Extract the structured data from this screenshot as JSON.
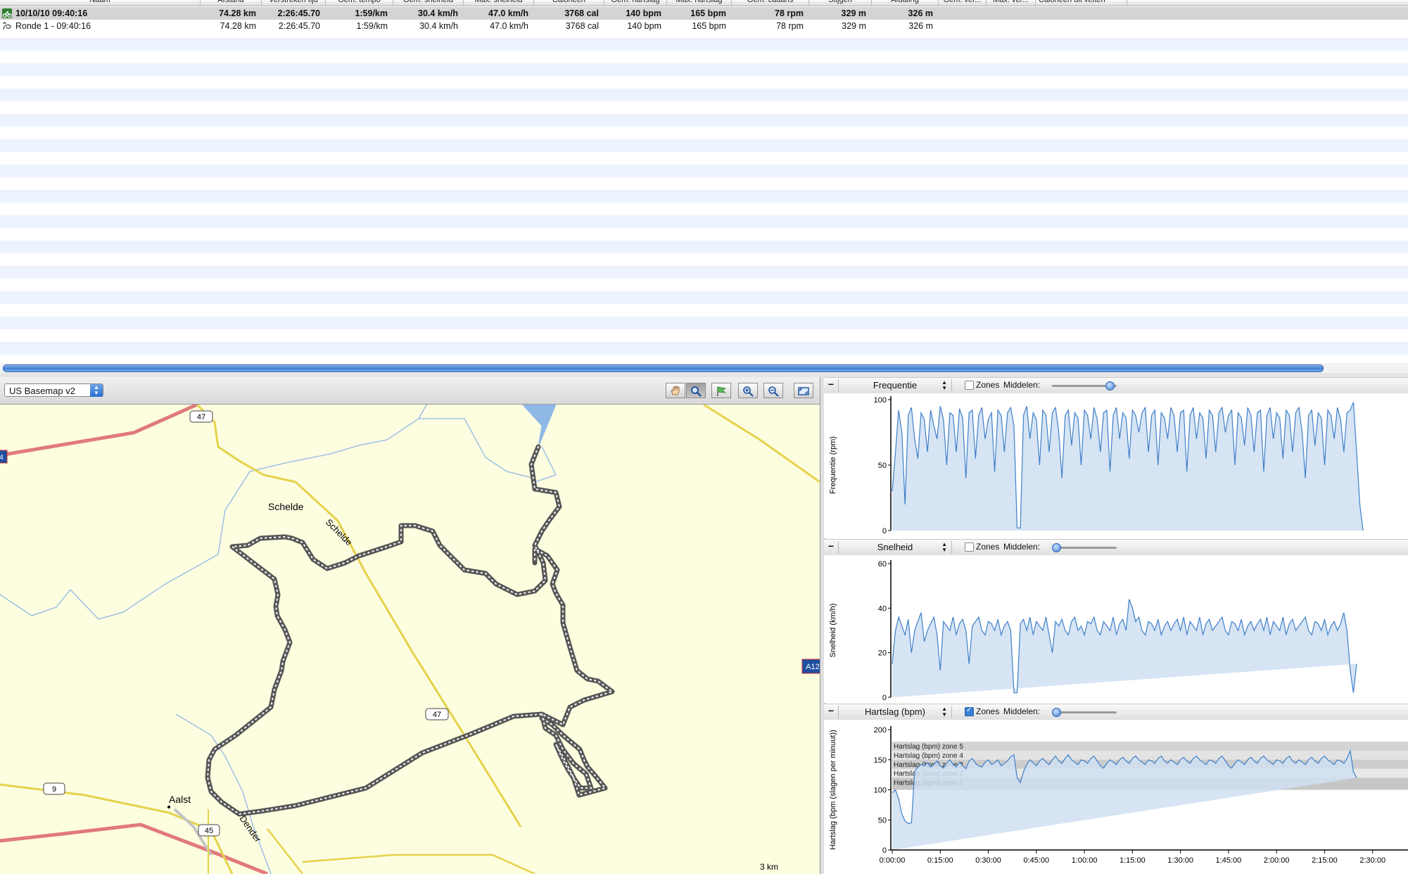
{
  "table": {
    "columns": [
      "Naam",
      "Afstand",
      "Verstreken tijd",
      "Gem. tempo",
      "Gem. snelheid",
      "Max. snelheid",
      "Calorieën",
      "Gem. hartslag",
      "Max. hartslag",
      "Gem. cadans",
      "Stijgen",
      "Afdaling",
      "Gem. ver...",
      "Max. ver...",
      "Calorieën uit vetten"
    ],
    "rows": [
      {
        "name": "10/10/10 09:40:16",
        "afstand": "74.28 km",
        "tijd": "2:26:45.70",
        "tempo": "1:59/km",
        "gem_snelheid": "30.4 km/h",
        "max_snelheid": "47.0 km/h",
        "calorieen": "3768 cal",
        "gem_hartslag": "140 bpm",
        "max_hartslag": "165 bpm",
        "cadans": "78 rpm",
        "stijgen": "329 m",
        "afdaling": "326 m"
      },
      {
        "name": "Ronde 1 - 09:40:16",
        "afstand": "74.28 km",
        "tijd": "2:26:45.70",
        "tempo": "1:59/km",
        "gem_snelheid": "30.4 km/h",
        "max_snelheid": "47.0 km/h",
        "calorieen": "3768 cal",
        "gem_hartslag": "140 bpm",
        "max_hartslag": "165 bpm",
        "cadans": "78 rpm",
        "stijgen": "329 m",
        "afdaling": "326 m"
      }
    ]
  },
  "map": {
    "basemap": "US Basemap v2",
    "tools": [
      "hand-icon",
      "magnifier-icon",
      "flag-icon",
      "zoom-in-icon",
      "zoom-out-icon",
      "fit-to-window-icon"
    ],
    "active_tool": "magnifier-icon",
    "labels": {
      "schelde1": "Schelde",
      "schelde2": "Schelde",
      "aalst": "Aalst",
      "dender": "Dender",
      "r47a": "47",
      "r47b": "47",
      "r9": "9",
      "r45": "45",
      "a14": "4",
      "a12": "A12",
      "scale": "3 km"
    },
    "colors": {
      "land": "#fdfde0",
      "highway": "#e07a7a",
      "road": "#e6d24a",
      "water": "#8fb8e6",
      "track": "#555555"
    }
  },
  "graphs": [
    {
      "title": "Frequentie",
      "ylabel": "Frequentie (rpm)",
      "zones_label": "Zones",
      "zones_checked": false,
      "middelen_label": "Middelen:",
      "slider_value": 0.9,
      "yticks": [
        "100",
        "50",
        "0"
      ]
    },
    {
      "title": "Snelheid",
      "ylabel": "Snelheid (km/h)",
      "zones_label": "Zones",
      "zones_checked": false,
      "middelen_label": "Middelen:",
      "slider_value": 0.05,
      "yticks": [
        "60",
        "40",
        "20",
        "0"
      ]
    },
    {
      "title": "Hartslag (bpm)",
      "ylabel": "Hartslag (bpm (slagen per minuut))",
      "zones_label": "Zones",
      "zones_checked": true,
      "middelen_label": "Middelen:",
      "slider_value": 0.05,
      "yticks": [
        "200",
        "150",
        "100",
        "50",
        "0"
      ],
      "zones": [
        "Hartslag (bpm) zone 5",
        "Hartslag (bpm) zone 4",
        "Hartslag (bpm) zone 3",
        "Hartslag (bpm) zone 2",
        "Hartslag (bpm) zone 1"
      ],
      "xticks": [
        "0:00:00",
        "0:15:00",
        "0:30:00",
        "0:45:00",
        "1:00:00",
        "1:15:00",
        "1:30:00",
        "1:45:00",
        "2:00:00",
        "2:15:00",
        "2:30:00",
        "2:45:00"
      ]
    }
  ],
  "chart_data": [
    {
      "type": "area",
      "ylabel": "Frequentie (rpm)",
      "ylim": [
        0,
        100
      ],
      "x_unit": "minutes",
      "xlim": [
        0,
        165
      ],
      "x": [
        0,
        1,
        2,
        3,
        4,
        5,
        6,
        7,
        8,
        9,
        10,
        11,
        12,
        13,
        14,
        15,
        16,
        17,
        18,
        19,
        20,
        21,
        22,
        23,
        24,
        25,
        26,
        27,
        28,
        29,
        30,
        31,
        32,
        33,
        34,
        35,
        36,
        37,
        38,
        39,
        40,
        41,
        42,
        43,
        44,
        45,
        46,
        47,
        48,
        49,
        50,
        51,
        52,
        53,
        54,
        55,
        56,
        57,
        58,
        59,
        60,
        61,
        62,
        63,
        64,
        65,
        66,
        67,
        68,
        69,
        70,
        71,
        72,
        73,
        74,
        75,
        76,
        77,
        78,
        79,
        80,
        81,
        82,
        83,
        84,
        85,
        86,
        87,
        88,
        89,
        90,
        91,
        92,
        93,
        94,
        95,
        96,
        97,
        98,
        99,
        100,
        101,
        102,
        103,
        104,
        105,
        106,
        107,
        108,
        109,
        110,
        111,
        112,
        113,
        114,
        115,
        116,
        117,
        118,
        119,
        120,
        121,
        122,
        123,
        124,
        125,
        126,
        127,
        128,
        129,
        130,
        131,
        132,
        133,
        134,
        135,
        136,
        137,
        138,
        139,
        140,
        141,
        142,
        143,
        144,
        145,
        146,
        147
      ],
      "values": [
        30,
        60,
        92,
        75,
        20,
        88,
        94,
        70,
        55,
        90,
        85,
        60,
        92,
        80,
        70,
        95,
        85,
        50,
        90,
        88,
        60,
        93,
        86,
        40,
        90,
        92,
        55,
        88,
        94,
        70,
        85,
        90,
        45,
        92,
        88,
        60,
        90,
        94,
        80,
        2,
        2,
        88,
        95,
        70,
        90,
        85,
        50,
        92,
        88,
        60,
        90,
        94,
        75,
        40,
        88,
        92,
        65,
        90,
        86,
        50,
        92,
        88,
        70,
        94,
        85,
        60,
        90,
        92,
        45,
        88,
        94,
        70,
        90,
        86,
        55,
        92,
        88,
        75,
        90,
        94,
        60,
        88,
        92,
        50,
        90,
        86,
        70,
        94,
        88,
        60,
        90,
        92,
        45,
        88,
        94,
        70,
        90,
        86,
        55,
        92,
        88,
        60,
        90,
        94,
        75,
        88,
        92,
        50,
        90,
        86,
        65,
        94,
        88,
        60,
        90,
        92,
        45,
        88,
        94,
        70,
        90,
        86,
        55,
        92,
        88,
        60,
        90,
        94,
        75,
        40,
        88,
        92,
        65,
        90,
        86,
        50,
        92,
        88,
        70,
        94,
        85,
        60,
        90,
        92,
        98,
        60,
        20,
        0
      ]
    },
    {
      "type": "area",
      "ylabel": "Snelheid (km/h)",
      "ylim": [
        0,
        60
      ],
      "x_unit": "minutes",
      "xlim": [
        0,
        165
      ],
      "x": [
        0,
        1,
        2,
        3,
        4,
        5,
        6,
        7,
        8,
        9,
        10,
        11,
        12,
        13,
        14,
        15,
        16,
        17,
        18,
        19,
        20,
        21,
        22,
        23,
        24,
        25,
        26,
        27,
        28,
        29,
        30,
        31,
        32,
        33,
        34,
        35,
        36,
        37,
        38,
        39,
        40,
        41,
        42,
        43,
        44,
        45,
        46,
        47,
        48,
        49,
        50,
        51,
        52,
        53,
        54,
        55,
        56,
        57,
        58,
        59,
        60,
        61,
        62,
        63,
        64,
        65,
        66,
        67,
        68,
        69,
        70,
        71,
        72,
        73,
        74,
        75,
        76,
        77,
        78,
        79,
        80,
        81,
        82,
        83,
        84,
        85,
        86,
        87,
        88,
        89,
        90,
        91,
        92,
        93,
        94,
        95,
        96,
        97,
        98,
        99,
        100,
        101,
        102,
        103,
        104,
        105,
        106,
        107,
        108,
        109,
        110,
        111,
        112,
        113,
        114,
        115,
        116,
        117,
        118,
        119,
        120,
        121,
        122,
        123,
        124,
        125,
        126,
        127,
        128,
        129,
        130,
        131,
        132,
        133,
        134,
        135,
        136,
        137,
        138,
        139,
        140,
        141,
        142,
        143,
        144,
        145,
        146,
        147
      ],
      "values": [
        15,
        30,
        36,
        32,
        28,
        35,
        20,
        30,
        34,
        38,
        25,
        30,
        33,
        36,
        28,
        12,
        34,
        32,
        30,
        36,
        28,
        33,
        35,
        30,
        15,
        32,
        34,
        36,
        30,
        28,
        34,
        33,
        30,
        35,
        28,
        32,
        34,
        30,
        2,
        2,
        33,
        35,
        30,
        36,
        28,
        34,
        32,
        30,
        36,
        28,
        20,
        34,
        32,
        35,
        30,
        28,
        34,
        36,
        30,
        32,
        28,
        34,
        33,
        36,
        30,
        28,
        34,
        32,
        30,
        36,
        28,
        33,
        35,
        30,
        44,
        40,
        34,
        36,
        30,
        28,
        34,
        33,
        30,
        35,
        28,
        32,
        34,
        30,
        33,
        35,
        30,
        36,
        28,
        34,
        32,
        30,
        36,
        28,
        33,
        35,
        30,
        32,
        34,
        36,
        30,
        28,
        34,
        33,
        30,
        35,
        28,
        32,
        34,
        30,
        33,
        35,
        30,
        36,
        28,
        34,
        32,
        30,
        36,
        28,
        33,
        35,
        30,
        32,
        34,
        36,
        30,
        28,
        34,
        33,
        30,
        35,
        28,
        32,
        34,
        30,
        33,
        38,
        30,
        12,
        2,
        15
      ]
    },
    {
      "type": "area",
      "ylabel": "Hartslag (bpm (slagen per minuut))",
      "ylim": [
        0,
        200
      ],
      "x_unit": "minutes",
      "xlim": [
        0,
        165
      ],
      "xticks": [
        "0:00:00",
        "0:15:00",
        "0:30:00",
        "0:45:00",
        "1:00:00",
        "1:15:00",
        "1:30:00",
        "1:45:00",
        "2:00:00",
        "2:15:00",
        "2:30:00",
        "2:45:00"
      ],
      "x": [
        0,
        1,
        2,
        3,
        4,
        5,
        6,
        7,
        8,
        9,
        10,
        11,
        12,
        13,
        14,
        15,
        16,
        17,
        18,
        19,
        20,
        21,
        22,
        23,
        24,
        25,
        26,
        27,
        28,
        29,
        30,
        31,
        32,
        33,
        34,
        35,
        36,
        37,
        38,
        39,
        40,
        41,
        42,
        43,
        44,
        45,
        46,
        47,
        48,
        49,
        50,
        51,
        52,
        53,
        54,
        55,
        56,
        57,
        58,
        59,
        60,
        61,
        62,
        63,
        64,
        65,
        66,
        67,
        68,
        69,
        70,
        71,
        72,
        73,
        74,
        75,
        76,
        77,
        78,
        79,
        80,
        81,
        82,
        83,
        84,
        85,
        86,
        87,
        88,
        89,
        90,
        91,
        92,
        93,
        94,
        95,
        96,
        97,
        98,
        99,
        100,
        101,
        102,
        103,
        104,
        105,
        106,
        107,
        108,
        109,
        110,
        111,
        112,
        113,
        114,
        115,
        116,
        117,
        118,
        119,
        120,
        121,
        122,
        123,
        124,
        125,
        126,
        127,
        128,
        129,
        130,
        131,
        132,
        133,
        134,
        135,
        136,
        137,
        138,
        139,
        140,
        141,
        142,
        143,
        144,
        145,
        146,
        147
      ],
      "values": [
        95,
        100,
        85,
        60,
        48,
        44,
        45,
        130,
        138,
        142,
        140,
        145,
        138,
        142,
        148,
        140,
        136,
        144,
        150,
        142,
        138,
        146,
        140,
        135,
        148,
        152,
        144,
        140,
        138,
        146,
        150,
        142,
        145,
        150,
        140,
        144,
        148,
        155,
        158,
        120,
        112,
        130,
        142,
        150,
        145,
        140,
        148,
        152,
        146,
        142,
        150,
        156,
        148,
        144,
        152,
        158,
        150,
        146,
        142,
        150,
        148,
        144,
        152,
        156,
        148,
        140,
        136,
        144,
        150,
        146,
        142,
        150,
        154,
        148,
        144,
        152,
        156,
        150,
        146,
        142,
        150,
        148,
        144,
        152,
        156,
        148,
        144,
        150,
        146,
        142,
        150,
        154,
        148,
        144,
        152,
        156,
        150,
        146,
        142,
        150,
        148,
        144,
        152,
        156,
        148,
        140,
        136,
        144,
        150,
        146,
        142,
        150,
        154,
        148,
        144,
        152,
        156,
        150,
        146,
        142,
        150,
        148,
        144,
        152,
        156,
        148,
        144,
        150,
        146,
        142,
        150,
        154,
        148,
        144,
        152,
        156,
        150,
        146,
        142,
        150,
        148,
        144,
        152,
        165,
        130,
        120
      ],
      "zones": [
        "Hartslag (bpm) zone 5",
        "Hartslag (bpm) zone 4",
        "Hartslag (bpm) zone 3",
        "Hartslag (bpm) zone 2",
        "Hartslag (bpm) zone 1"
      ]
    }
  ]
}
